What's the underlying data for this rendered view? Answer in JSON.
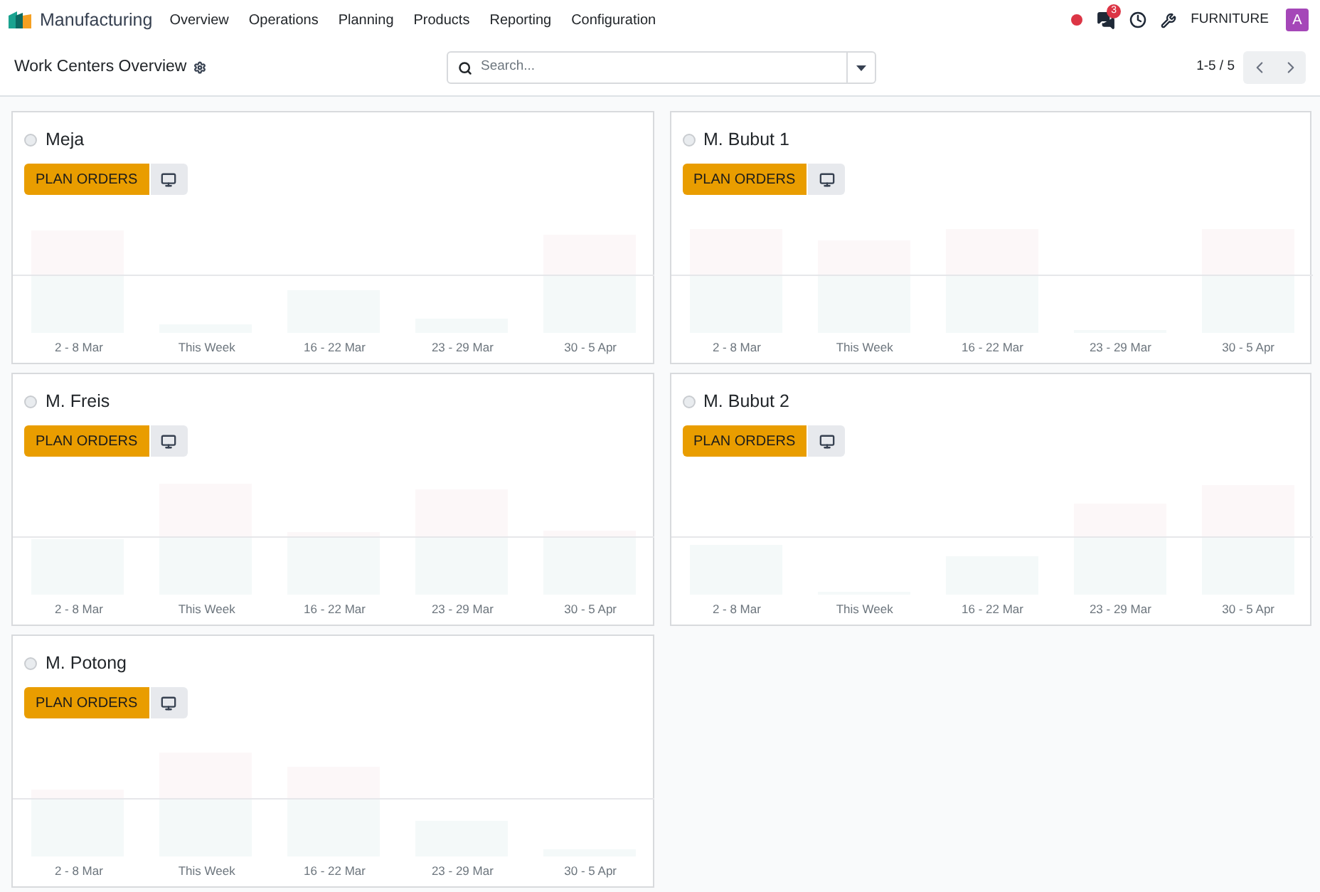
{
  "app": {
    "name": "Manufacturing"
  },
  "menu": [
    {
      "label": "Overview"
    },
    {
      "label": "Operations"
    },
    {
      "label": "Planning"
    },
    {
      "label": "Products"
    },
    {
      "label": "Reporting"
    },
    {
      "label": "Configuration"
    }
  ],
  "systray": {
    "messages_badge": "3",
    "company": "FURNITURE",
    "avatar": "A"
  },
  "control_panel": {
    "title": "Work Centers Overview",
    "search": {
      "placeholder": "Search..."
    },
    "pager": "1-5 / 5"
  },
  "work_centers": [
    {
      "name": "Meja",
      "selected": false,
      "button": "PLAN ORDERS",
      "weeks": [
        "2 - 8 Mar",
        "This Week",
        "16 - 22 Mar",
        "23 - 29 Mar",
        "30 - 5 Apr"
      ]
    },
    {
      "name": "M. Bubut 1",
      "selected": false,
      "button": "PLAN ORDERS",
      "weeks": [
        "2 - 8 Mar",
        "This Week",
        "16 - 22 Mar",
        "23 - 29 Mar",
        "30 - 5 Apr"
      ]
    },
    {
      "name": "M. Freis",
      "selected": false,
      "button": "PLAN ORDERS",
      "weeks": [
        "2 - 8 Mar",
        "This Week",
        "16 - 22 Mar",
        "23 - 29 Mar",
        "30 - 5 Apr"
      ]
    },
    {
      "name": "M. Bubut 2",
      "selected": false,
      "button": "PLAN ORDERS",
      "weeks": [
        "2 - 8 Mar",
        "This Week",
        "16 - 22 Mar",
        "23 - 29 Mar",
        "30 - 5 Apr"
      ]
    },
    {
      "name": "M. Potong",
      "selected": false,
      "button": "PLAN ORDERS",
      "weeks": [
        "2 - 8 Mar",
        "This Week",
        "16 - 22 Mar",
        "23 - 29 Mar",
        "30 - 5 Apr"
      ]
    }
  ]
}
